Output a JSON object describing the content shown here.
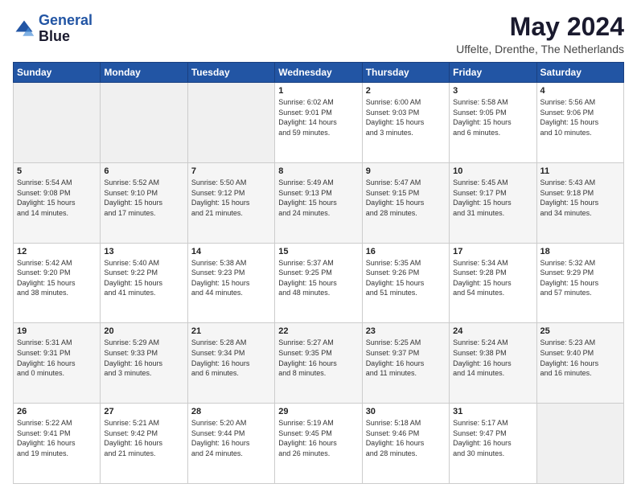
{
  "header": {
    "logo_line1": "General",
    "logo_line2": "Blue",
    "title": "May 2024",
    "subtitle": "Uffelte, Drenthe, The Netherlands"
  },
  "calendar": {
    "days_of_week": [
      "Sunday",
      "Monday",
      "Tuesday",
      "Wednesday",
      "Thursday",
      "Friday",
      "Saturday"
    ],
    "weeks": [
      [
        {
          "day": "",
          "info": ""
        },
        {
          "day": "",
          "info": ""
        },
        {
          "day": "",
          "info": ""
        },
        {
          "day": "1",
          "info": "Sunrise: 6:02 AM\nSunset: 9:01 PM\nDaylight: 14 hours\nand 59 minutes."
        },
        {
          "day": "2",
          "info": "Sunrise: 6:00 AM\nSunset: 9:03 PM\nDaylight: 15 hours\nand 3 minutes."
        },
        {
          "day": "3",
          "info": "Sunrise: 5:58 AM\nSunset: 9:05 PM\nDaylight: 15 hours\nand 6 minutes."
        },
        {
          "day": "4",
          "info": "Sunrise: 5:56 AM\nSunset: 9:06 PM\nDaylight: 15 hours\nand 10 minutes."
        }
      ],
      [
        {
          "day": "5",
          "info": "Sunrise: 5:54 AM\nSunset: 9:08 PM\nDaylight: 15 hours\nand 14 minutes."
        },
        {
          "day": "6",
          "info": "Sunrise: 5:52 AM\nSunset: 9:10 PM\nDaylight: 15 hours\nand 17 minutes."
        },
        {
          "day": "7",
          "info": "Sunrise: 5:50 AM\nSunset: 9:12 PM\nDaylight: 15 hours\nand 21 minutes."
        },
        {
          "day": "8",
          "info": "Sunrise: 5:49 AM\nSunset: 9:13 PM\nDaylight: 15 hours\nand 24 minutes."
        },
        {
          "day": "9",
          "info": "Sunrise: 5:47 AM\nSunset: 9:15 PM\nDaylight: 15 hours\nand 28 minutes."
        },
        {
          "day": "10",
          "info": "Sunrise: 5:45 AM\nSunset: 9:17 PM\nDaylight: 15 hours\nand 31 minutes."
        },
        {
          "day": "11",
          "info": "Sunrise: 5:43 AM\nSunset: 9:18 PM\nDaylight: 15 hours\nand 34 minutes."
        }
      ],
      [
        {
          "day": "12",
          "info": "Sunrise: 5:42 AM\nSunset: 9:20 PM\nDaylight: 15 hours\nand 38 minutes."
        },
        {
          "day": "13",
          "info": "Sunrise: 5:40 AM\nSunset: 9:22 PM\nDaylight: 15 hours\nand 41 minutes."
        },
        {
          "day": "14",
          "info": "Sunrise: 5:38 AM\nSunset: 9:23 PM\nDaylight: 15 hours\nand 44 minutes."
        },
        {
          "day": "15",
          "info": "Sunrise: 5:37 AM\nSunset: 9:25 PM\nDaylight: 15 hours\nand 48 minutes."
        },
        {
          "day": "16",
          "info": "Sunrise: 5:35 AM\nSunset: 9:26 PM\nDaylight: 15 hours\nand 51 minutes."
        },
        {
          "day": "17",
          "info": "Sunrise: 5:34 AM\nSunset: 9:28 PM\nDaylight: 15 hours\nand 54 minutes."
        },
        {
          "day": "18",
          "info": "Sunrise: 5:32 AM\nSunset: 9:29 PM\nDaylight: 15 hours\nand 57 minutes."
        }
      ],
      [
        {
          "day": "19",
          "info": "Sunrise: 5:31 AM\nSunset: 9:31 PM\nDaylight: 16 hours\nand 0 minutes."
        },
        {
          "day": "20",
          "info": "Sunrise: 5:29 AM\nSunset: 9:33 PM\nDaylight: 16 hours\nand 3 minutes."
        },
        {
          "day": "21",
          "info": "Sunrise: 5:28 AM\nSunset: 9:34 PM\nDaylight: 16 hours\nand 6 minutes."
        },
        {
          "day": "22",
          "info": "Sunrise: 5:27 AM\nSunset: 9:35 PM\nDaylight: 16 hours\nand 8 minutes."
        },
        {
          "day": "23",
          "info": "Sunrise: 5:25 AM\nSunset: 9:37 PM\nDaylight: 16 hours\nand 11 minutes."
        },
        {
          "day": "24",
          "info": "Sunrise: 5:24 AM\nSunset: 9:38 PM\nDaylight: 16 hours\nand 14 minutes."
        },
        {
          "day": "25",
          "info": "Sunrise: 5:23 AM\nSunset: 9:40 PM\nDaylight: 16 hours\nand 16 minutes."
        }
      ],
      [
        {
          "day": "26",
          "info": "Sunrise: 5:22 AM\nSunset: 9:41 PM\nDaylight: 16 hours\nand 19 minutes."
        },
        {
          "day": "27",
          "info": "Sunrise: 5:21 AM\nSunset: 9:42 PM\nDaylight: 16 hours\nand 21 minutes."
        },
        {
          "day": "28",
          "info": "Sunrise: 5:20 AM\nSunset: 9:44 PM\nDaylight: 16 hours\nand 24 minutes."
        },
        {
          "day": "29",
          "info": "Sunrise: 5:19 AM\nSunset: 9:45 PM\nDaylight: 16 hours\nand 26 minutes."
        },
        {
          "day": "30",
          "info": "Sunrise: 5:18 AM\nSunset: 9:46 PM\nDaylight: 16 hours\nand 28 minutes."
        },
        {
          "day": "31",
          "info": "Sunrise: 5:17 AM\nSunset: 9:47 PM\nDaylight: 16 hours\nand 30 minutes."
        },
        {
          "day": "",
          "info": ""
        }
      ]
    ]
  }
}
